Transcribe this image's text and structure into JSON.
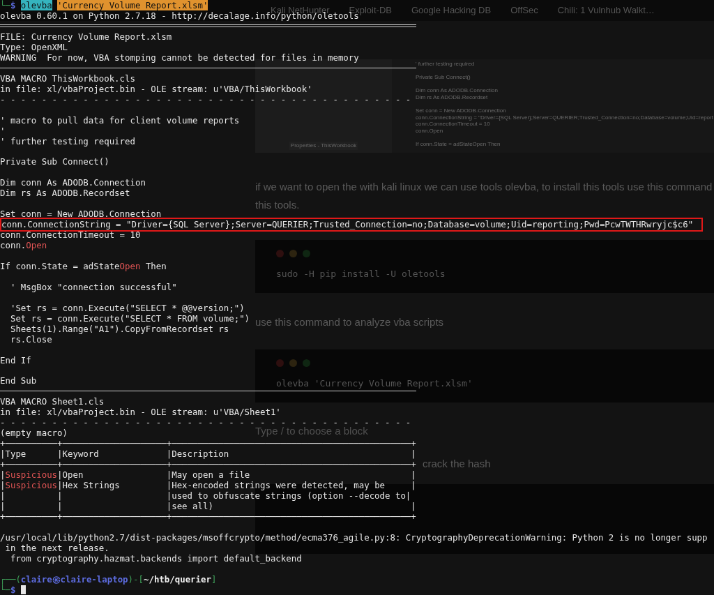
{
  "browser": {
    "bookmarks": [
      "Kali NetHunter",
      "Exploit-DB",
      "Google Hacking DB",
      "OffSec",
      "Chili: 1 Vulnhub Walkt…"
    ]
  },
  "article": {
    "screenshot": {
      "pane_label": "Properties - ThisWorkbook",
      "code_groups": [
        [
          "' further testing required"
        ],
        [
          "Private Sub Connect()"
        ],
        [
          "Dim conn As ADODB.Connection",
          "Dim rs As ADODB.Recordset"
        ],
        [
          "Set conn = New ADODB.Connection",
          "conn.ConnectionString = \"Driver={SQL Server};Server=QUERIER;Trusted_Connection=no;Database=volume;Uid=report",
          "conn.ConnectionTimeout = 10",
          "conn.Open"
        ],
        [
          "If conn.State = adStateOpen Then"
        ]
      ]
    },
    "blocks": [
      {
        "kind": "paragraph",
        "lines": [
          "if we want to open the with kali linux we can use tools olevba, to install this tools use this command",
          "this tools."
        ]
      },
      {
        "kind": "code",
        "text": "sudo -H pip install -U oletools"
      },
      {
        "kind": "paragraph",
        "lines": [
          "use this command to analyze vba scripts"
        ]
      },
      {
        "kind": "code",
        "text": "olevba 'Currency Volume Report.xlsm'"
      },
      {
        "kind": "placeholder",
        "text": "Type / to choose a block"
      },
      {
        "kind": "paragraph",
        "lines": [
          "crack the hash"
        ]
      },
      {
        "kind": "code"
      }
    ]
  },
  "terminal": {
    "lines": [
      {
        "kind": "text",
        "parts": [
          {
            "text": "└─",
            "kind": "frame"
          },
          {
            "text": "$",
            "kind": "dollar"
          },
          {
            "text": "olevba",
            "kind": "cmd",
            "space_before": true
          },
          {
            "text": "'Currency Volume Report.xlsm'",
            "kind": "arg",
            "space_before": true
          }
        ]
      },
      {
        "kind": "text",
        "text": "olevba 0.60.1 on Python 2.7.18 - http://decalage.info/python/oletools"
      },
      {
        "kind": "double-rule"
      },
      {
        "kind": "text",
        "text": "FILE: Currency Volume Report.xlsm"
      },
      {
        "kind": "text",
        "text": "Type: OpenXML"
      },
      {
        "kind": "text",
        "text": "WARNING  For now, VBA stomping cannot be detected for files in memory"
      },
      {
        "kind": "rule"
      },
      {
        "kind": "text",
        "text": "VBA MACRO ThisWorkbook.cls"
      },
      {
        "kind": "text",
        "text": "in file: xl/vbaProject.bin - OLE stream: u'VBA/ThisWorkbook'"
      },
      {
        "kind": "text",
        "text": "- - - - - - - - - - - - - - - - - - - - - - - - - - - - - - - - - - - - - - - -"
      },
      {
        "kind": "blank"
      },
      {
        "kind": "text",
        "text": "' macro to pull data for client volume reports"
      },
      {
        "kind": "text",
        "text": "'"
      },
      {
        "kind": "text",
        "text": "' further testing required"
      },
      {
        "kind": "blank"
      },
      {
        "kind": "text",
        "text": "Private Sub Connect()"
      },
      {
        "kind": "blank"
      },
      {
        "kind": "text",
        "text": "Dim conn As ADODB.Connection"
      },
      {
        "kind": "text",
        "text": "Dim rs As ADODB.Recordset"
      },
      {
        "kind": "blank"
      },
      {
        "kind": "text",
        "text": "Set conn = New ADODB.Connection"
      },
      {
        "kind": "boxed",
        "text": "conn.ConnectionString = \"Driver={SQL Server};Server=QUERIER;Trusted_Connection=no;Database=volume;Uid=reporting;Pwd=PcwTWTHRwryjc$c6\""
      },
      {
        "kind": "text",
        "text": "conn.ConnectionTimeout = 10"
      },
      {
        "kind": "text",
        "parts": [
          {
            "text": "conn.",
            "kind": "plain"
          },
          {
            "text": "Open",
            "kind": "red"
          }
        ]
      },
      {
        "kind": "blank"
      },
      {
        "kind": "text",
        "parts": [
          {
            "text": "If conn.State = adState",
            "kind": "plain"
          },
          {
            "text": "Open",
            "kind": "red"
          },
          {
            "text": " Then",
            "kind": "plain"
          }
        ]
      },
      {
        "kind": "blank"
      },
      {
        "kind": "text",
        "text": "  ' MsgBox \"connection successful\""
      },
      {
        "kind": "blank"
      },
      {
        "kind": "text",
        "text": "  'Set rs = conn.Execute(\"SELECT * @@version;\")"
      },
      {
        "kind": "text",
        "text": "  Set rs = conn.Execute(\"SELECT * FROM volume;\")"
      },
      {
        "kind": "text",
        "text": "  Sheets(1).Range(\"A1\").CopyFromRecordset rs"
      },
      {
        "kind": "text",
        "text": "  rs.Close"
      },
      {
        "kind": "blank"
      },
      {
        "kind": "text",
        "text": "End If"
      },
      {
        "kind": "blank"
      },
      {
        "kind": "text",
        "text": "End Sub"
      },
      {
        "kind": "rule"
      },
      {
        "kind": "text",
        "text": "VBA MACRO Sheet1.cls"
      },
      {
        "kind": "text",
        "text": "in file: xl/vbaProject.bin - OLE stream: u'VBA/Sheet1'"
      },
      {
        "kind": "text",
        "text": "- - - - - - - - - - - - - - - - - - - - - - - - - - - - - - - - - - - - - - - -"
      },
      {
        "kind": "text",
        "text": "(empty macro)"
      },
      {
        "kind": "text",
        "text": "+──────────+────────────────────+──────────────────────────────────────────────+"
      },
      {
        "kind": "text",
        "text": "|Type      |Keyword             |Description                                   |"
      },
      {
        "kind": "text",
        "text": "+──────────+────────────────────+──────────────────────────────────────────────+"
      },
      {
        "kind": "text",
        "parts": [
          {
            "text": "|",
            "kind": "plain"
          },
          {
            "text": "Suspicious",
            "kind": "red"
          },
          {
            "text": "|Open                |May open a file                               |",
            "kind": "plain"
          }
        ]
      },
      {
        "kind": "text",
        "parts": [
          {
            "text": "|",
            "kind": "plain"
          },
          {
            "text": "Suspicious",
            "kind": "red"
          },
          {
            "text": "|Hex Strings         |Hex-encoded strings were detected, may be     |",
            "kind": "plain"
          }
        ]
      },
      {
        "kind": "text",
        "text": "|          |                    |used to obfuscate strings (option --decode to|"
      },
      {
        "kind": "text",
        "text": "|          |                    |see all)                                      |"
      },
      {
        "kind": "text",
        "text": "+──────────+────────────────────+──────────────────────────────────────────────+"
      },
      {
        "kind": "blank"
      },
      {
        "kind": "text",
        "text": "/usr/local/lib/python2.7/dist-packages/msoffcrypto/method/ecma376_agile.py:8: CryptographyDeprecationWarning: Python 2 is no longer supp"
      },
      {
        "kind": "text",
        "text": " in the next release."
      },
      {
        "kind": "text",
        "text": "  from cryptography.hazmat.backends import default_backend"
      },
      {
        "kind": "blank"
      },
      {
        "kind": "text",
        "parts": [
          {
            "text": "┌──(",
            "kind": "frame"
          },
          {
            "text": "claire㉿claire-laptop",
            "kind": "host"
          },
          {
            "text": ")-[",
            "kind": "frame"
          },
          {
            "text": "~/htb/querier",
            "kind": "cwd"
          },
          {
            "text": "]",
            "kind": "frame"
          }
        ]
      },
      {
        "kind": "text",
        "cursor": true,
        "parts": [
          {
            "text": "└─",
            "kind": "frame"
          },
          {
            "text": "$",
            "kind": "dollar"
          }
        ]
      }
    ]
  }
}
